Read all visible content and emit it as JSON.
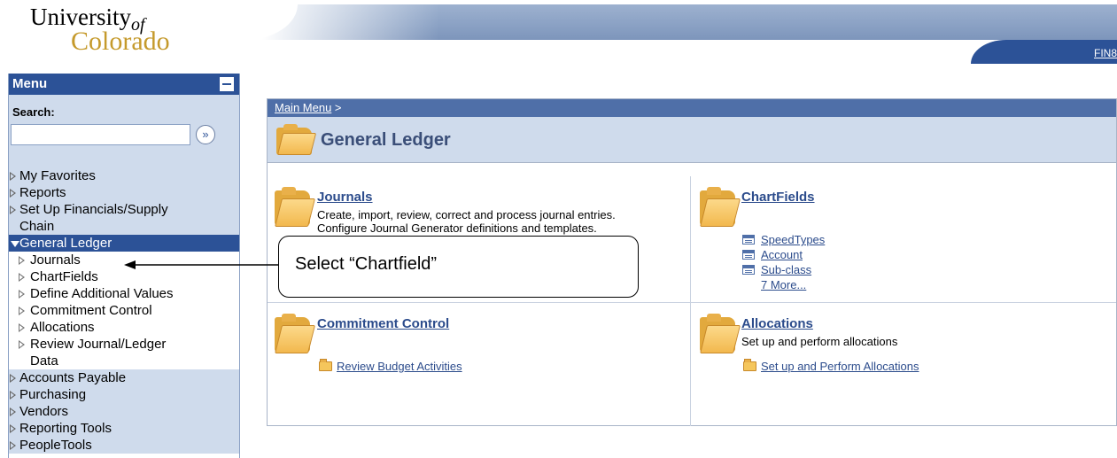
{
  "header": {
    "logo_line1": "University",
    "logo_of": "of",
    "logo_line2": "Colorado",
    "fin_link": "FIN8"
  },
  "menu": {
    "title": "Menu",
    "search_label": "Search:",
    "search_go": "»",
    "items_top": [
      "My Favorites",
      "Reports",
      "Set Up Financials/Supply",
      "Chain"
    ],
    "selected": "General Ledger",
    "sub_items": [
      "Journals",
      "ChartFields",
      "Define Additional Values",
      "Commitment Control",
      "Allocations",
      "Review Journal/Ledger",
      "Data"
    ],
    "items_bottom": [
      "Accounts Payable",
      "Purchasing",
      "Vendors",
      "Reporting Tools",
      "PeopleTools"
    ]
  },
  "main": {
    "breadcrumb_link": "Main Menu",
    "breadcrumb_sep": " >",
    "title": "General Ledger",
    "journals": {
      "title": "Journals",
      "desc1": "Create, import, review, correct and process journal entries.",
      "desc2": "Configure Journal Generator definitions and templates."
    },
    "chartfields": {
      "title": "ChartFields",
      "links": [
        "SpeedTypes",
        "Account",
        "Sub-class"
      ],
      "more": "7 More..."
    },
    "commitment": {
      "title": "Commitment Control",
      "link": "Review Budget Activities"
    },
    "allocations": {
      "title": "Allocations",
      "desc": "Set up and perform allocations",
      "link": "Set up and Perform Allocations"
    }
  },
  "callout": {
    "text": "Select “Chartfield”"
  }
}
